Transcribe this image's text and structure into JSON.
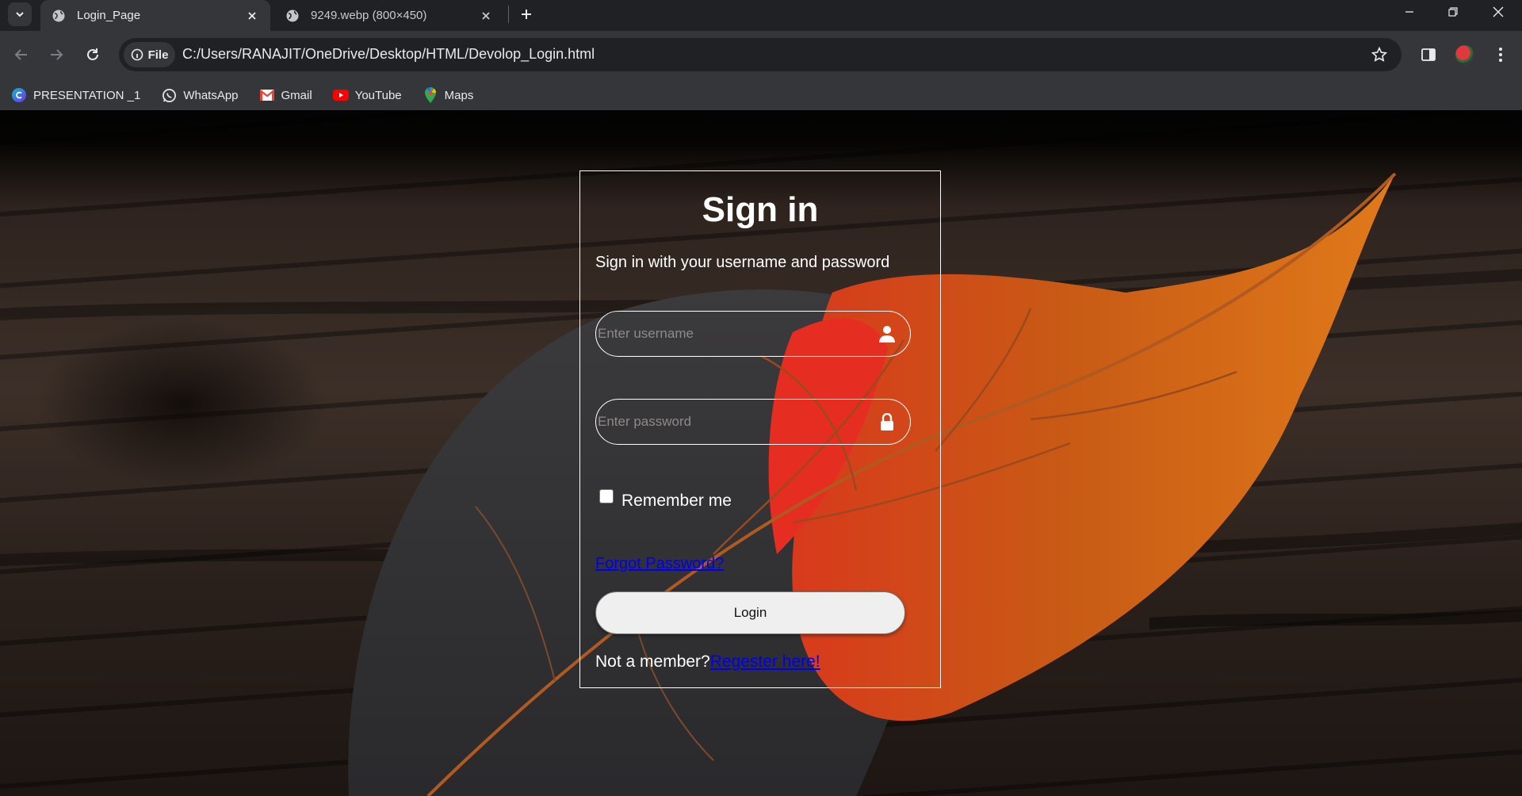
{
  "browser": {
    "tabs": [
      {
        "title": "Login_Page",
        "active": true
      },
      {
        "title": "9249.webp (800×450)",
        "active": false
      }
    ],
    "omnibox": {
      "chip_label": "File",
      "url": "C:/Users/RANAJIT/OneDrive/Desktop/HTML/Devolop_Login.html"
    },
    "bookmarks": [
      {
        "label": "PRESENTATION _1",
        "icon": "canva-icon"
      },
      {
        "label": "WhatsApp",
        "icon": "whatsapp-icon"
      },
      {
        "label": "Gmail",
        "icon": "gmail-icon"
      },
      {
        "label": "YouTube",
        "icon": "youtube-icon"
      },
      {
        "label": "Maps",
        "icon": "maps-icon"
      }
    ]
  },
  "login": {
    "title": "Sign in",
    "subtitle": "Sign in with your username and password",
    "username_placeholder": "Enter username",
    "password_placeholder": "Enter password",
    "remember_label": "Remember me",
    "forgot_link": "Forgot Password?",
    "login_button": "Login",
    "register_prefix": "Not a member?",
    "register_link": "Regester here!"
  },
  "colors": {
    "link": "#0000ee",
    "chrome_dark": "#202124",
    "chrome_toolbar": "#35363a"
  }
}
